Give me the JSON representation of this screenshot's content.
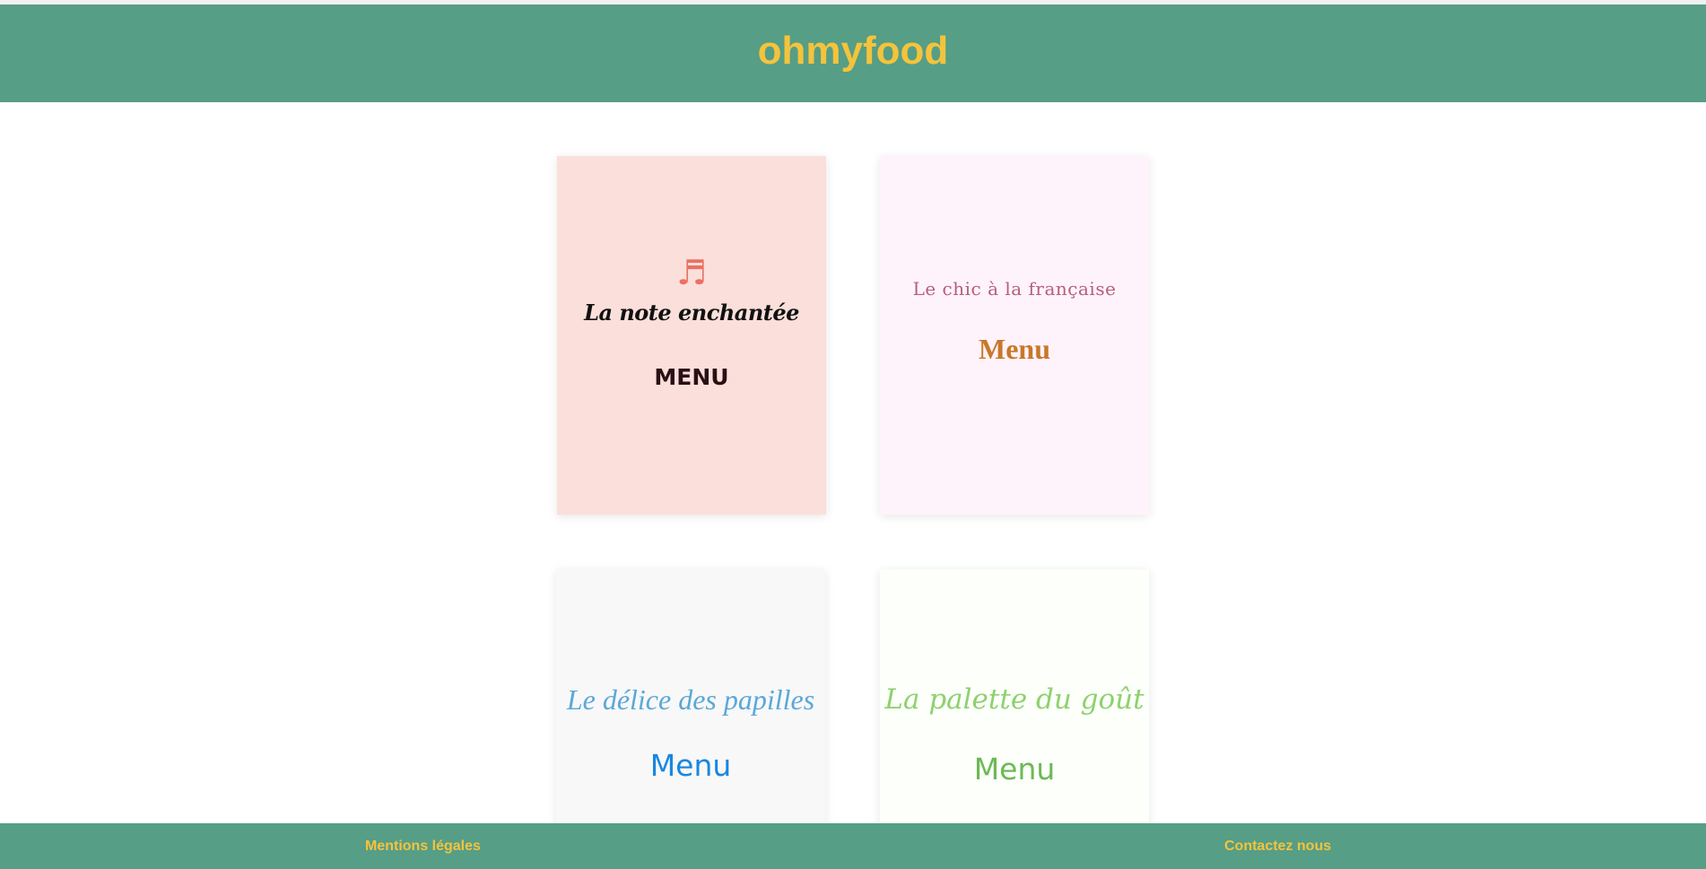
{
  "header": {
    "logo": "ohmyfood"
  },
  "restaurants": [
    {
      "title": "La note enchantée",
      "menu_label": "MENU",
      "icon": "music-note-icon",
      "icon_glyph": "♬"
    },
    {
      "title": "Le chic à la française",
      "menu_label": "Menu"
    },
    {
      "title": "Le délice des papilles",
      "menu_label": "Menu"
    },
    {
      "title": "La palette du goût",
      "menu_label": "Menu"
    }
  ],
  "footer": {
    "left_link": "Mentions légales",
    "right_link": "Contactez nous"
  },
  "colors": {
    "brand_green": "#569e86",
    "brand_yellow": "#f5c33b"
  }
}
